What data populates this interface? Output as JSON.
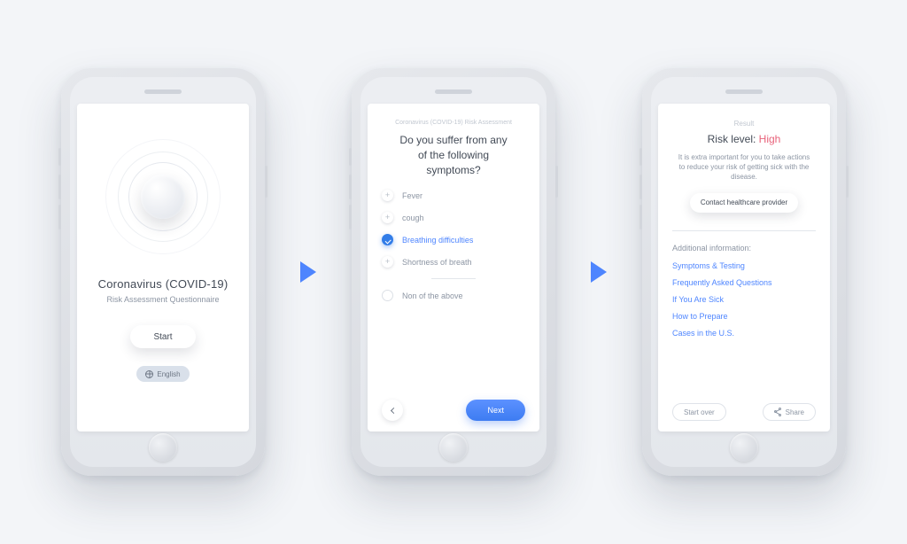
{
  "screen1": {
    "title": "Coronavirus (COVID-19)",
    "subtitle": "Risk Assessment Questionnaire",
    "start_label": "Start",
    "language_label": "English"
  },
  "screen2": {
    "breadcrumb": "Coronavirus (COVID-19) Risk Assessment",
    "question": "Do you suffer from any of the following symptoms?",
    "options": [
      {
        "label": "Fever",
        "selected": false
      },
      {
        "label": "cough",
        "selected": false
      },
      {
        "label": "Breathing difficulties",
        "selected": true
      },
      {
        "label": "Shortness of breath",
        "selected": false
      }
    ],
    "none_label": "Non of the above",
    "next_label": "Next"
  },
  "screen3": {
    "breadcrumb": "Result",
    "risk_prefix": "Risk level: ",
    "risk_value": "High",
    "description": "It is extra important for you to take actions to reduce your risk of getting sick with the disease.",
    "contact_label": "Contact healthcare provider",
    "section_label": "Additional information:",
    "links": [
      "Symptoms & Testing",
      "Frequently Asked Questions",
      "If You Are Sick",
      "How to Prepare",
      "Cases in the U.S."
    ],
    "start_over_label": "Start over",
    "share_label": "Share"
  }
}
